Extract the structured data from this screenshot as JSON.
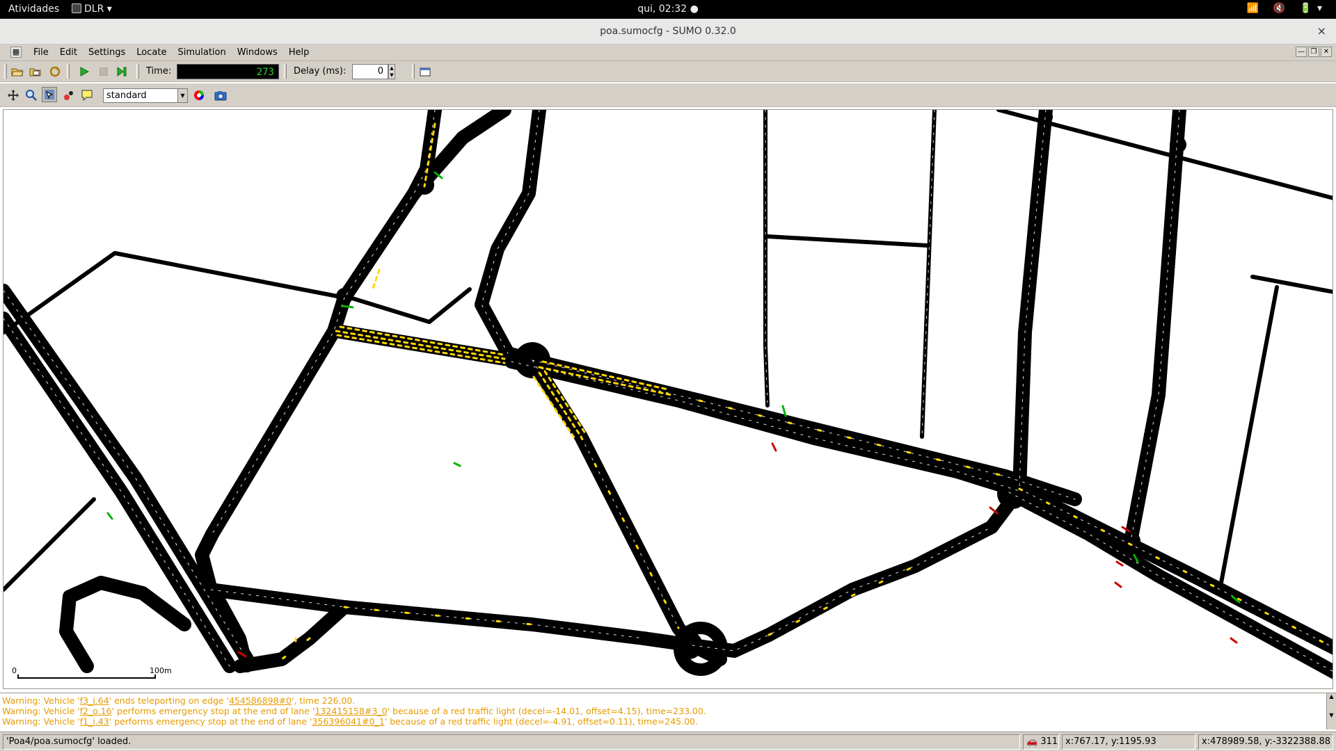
{
  "topbar": {
    "activities": "Atividades",
    "app_name": "DLR ▾",
    "clock": "qui, 02:32 ●",
    "tray": "📶 🔇 🔋▾"
  },
  "window": {
    "title": "poa.sumocfg - SUMO 0.32.0",
    "close": "×"
  },
  "menu": {
    "items": [
      "File",
      "Edit",
      "Settings",
      "Locate",
      "Simulation",
      "Windows",
      "Help"
    ],
    "mdi_minimize": "—",
    "mdi_restore": "❐",
    "mdi_close": "✕"
  },
  "toolbar": {
    "time_label": "Time:",
    "time_value": "273",
    "delay_label": "Delay (ms):",
    "delay_value": "0",
    "scheme_value": "standard"
  },
  "scalebar": {
    "zero": "0",
    "hundred": "100m"
  },
  "messages": [
    {
      "prefix": "Warning: Vehicle '",
      "vehicle": "f3_i.64",
      "mid": "' ends teleporting on edge '",
      "ref": "454586898#0",
      "suffix": "', time 226.00."
    },
    {
      "prefix": "Warning: Vehicle '",
      "vehicle": "f2_o.16",
      "mid": "' performs emergency stop at the end of lane '",
      "ref": "132415158#3_0",
      "suffix": "' because of a red traffic light (decel=-14.01, offset=4.15), time=233.00."
    },
    {
      "prefix": "Warning: Vehicle '",
      "vehicle": "f1_i.43",
      "mid": "' performs emergency stop at the end of lane '",
      "ref": "356396041#0_1",
      "suffix": "' because of a red traffic light (decel=-4.91, offset=0.11), time=245.00."
    }
  ],
  "status": {
    "message": "'Poa4/poa.sumocfg' loaded.",
    "vehicle_count": "311",
    "coords_net": "x:767.17, y:1195.93",
    "coords_geo": "x:478989.58, y:-3322388.88"
  },
  "colors": {
    "road": "#000000",
    "vehicle": "#ffd700",
    "lane_marking": "#ffffff",
    "warning_text": "#e69a00",
    "time_digits": "#2fd32f",
    "tl_green": "#00b400",
    "tl_red": "#c80000"
  }
}
